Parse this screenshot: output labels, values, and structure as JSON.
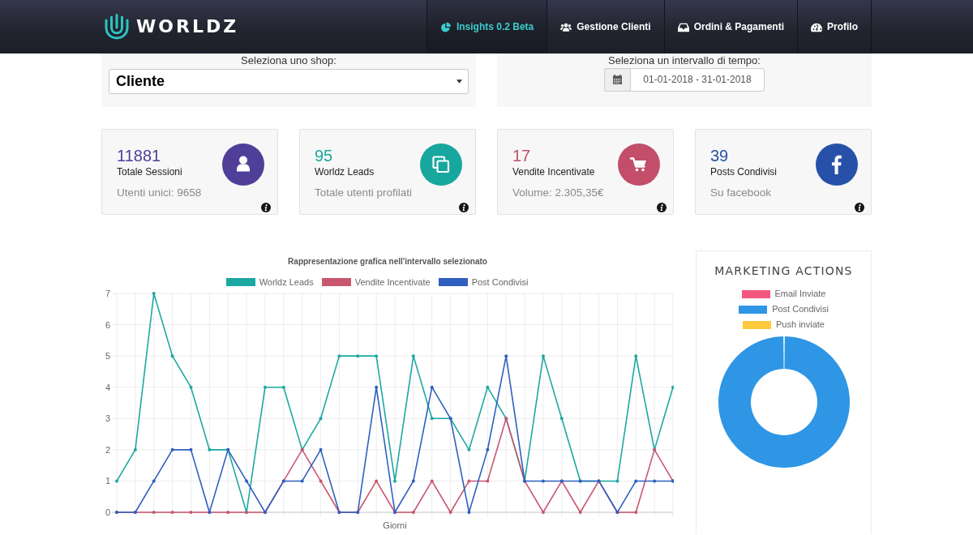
{
  "header": {
    "logo": "WORLDZ",
    "nav": [
      {
        "label": "Insights 0.2 Beta",
        "selected": true
      },
      {
        "label": "Gestione Clienti",
        "selected": false
      },
      {
        "label": "Ordini & Pagamenti",
        "selected": false
      },
      {
        "label": "Profilo",
        "selected": false
      }
    ]
  },
  "filters": [
    {
      "kind": "select",
      "label": "Seleziona uno shop:",
      "value": "Cliente"
    },
    {
      "kind": "date_range",
      "label": "Seleziona un intervallo di tempo:",
      "value": "01-01-2018 - 31-01-2018"
    }
  ],
  "stats": [
    {
      "value": "11881",
      "label": "Totale Sessioni",
      "detail": "Utenti unici: 9658",
      "color": "#4f3f98"
    },
    {
      "value": "95",
      "label": "Worldz Leads",
      "detail": "Totale utenti profilati",
      "color": "#17a79e"
    },
    {
      "value": "17",
      "label": "Vendite Incentivate",
      "detail": "Volume: 2.305,35€",
      "color": "#c24e6a"
    },
    {
      "value": "39",
      "label": "Posts Condivisi",
      "detail": "Su facebook",
      "color": "#2751a8"
    }
  ],
  "chart": {
    "chart_data": {
      "type": "line",
      "title": "Rappresentazione grafica nell'intervallo selezionato",
      "legend": "top",
      "grid": true,
      "xlabel": "Giorni",
      "ylim": [
        0,
        7
      ],
      "yticks": [
        0,
        1,
        2,
        3,
        4,
        5,
        6,
        7
      ],
      "series": [
        {
          "name": "Worldz Leads",
          "color": "#1ba8a2",
          "values": [
            1,
            2,
            7,
            5,
            4,
            2,
            2,
            0,
            4,
            4,
            2,
            3,
            5,
            5,
            5,
            1,
            5,
            3,
            3,
            2,
            4,
            3,
            1,
            5,
            3,
            1,
            1,
            1,
            5,
            2,
            4
          ]
        },
        {
          "name": "Vendite Incentivate",
          "color": "#c9566f",
          "values": [
            0,
            0,
            0,
            0,
            0,
            0,
            0,
            0,
            0,
            1,
            2,
            1,
            0,
            0,
            1,
            0,
            0,
            1,
            0,
            1,
            1,
            3,
            1,
            0,
            1,
            0,
            1,
            0,
            0,
            2,
            1
          ]
        },
        {
          "name": "Post Condivisi",
          "color": "#2f5fbf",
          "values": [
            0,
            0,
            1,
            2,
            2,
            0,
            2,
            1,
            0,
            1,
            1,
            2,
            0,
            0,
            4,
            0,
            1,
            4,
            3,
            0,
            2,
            5,
            1,
            1,
            1,
            1,
            1,
            0,
            1,
            1,
            1
          ]
        }
      ]
    }
  },
  "marketing": {
    "title": "MARKETING ACTIONS",
    "legend": [
      {
        "label": "Email Inviate",
        "color": "#f4577d",
        "fills_ring": false
      },
      {
        "label": "Post Condivisi",
        "color": "#2e96e5",
        "fills_ring": true
      },
      {
        "label": "Push inviate",
        "color": "#ffc93c",
        "fills_ring": false
      }
    ]
  }
}
